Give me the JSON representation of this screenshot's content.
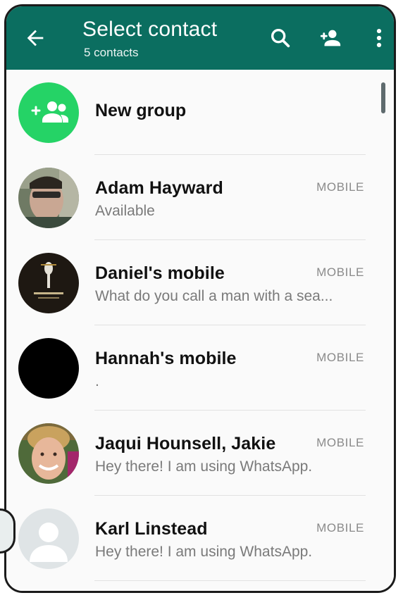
{
  "header": {
    "title": "Select contact",
    "subtitle": "5 contacts",
    "bg_color": "#0b6e60",
    "icons": [
      "back-arrow-icon",
      "search-icon",
      "add-contact-icon",
      "more-vert-icon"
    ]
  },
  "new_group": {
    "label": "New group",
    "icon": "group-add-icon",
    "accent": "#25d366"
  },
  "contacts": [
    {
      "name": "Adam Hayward",
      "status": "Available",
      "type": "MOBILE"
    },
    {
      "name": "Daniel's mobile",
      "status": "What do you call a man with a sea...",
      "type": "MOBILE"
    },
    {
      "name": "Hannah's mobile",
      "status": ".",
      "type": "MOBILE"
    },
    {
      "name": "Jaqui Hounsell, Jakie",
      "status": "Hey there! I am using WhatsApp.",
      "type": "MOBILE"
    },
    {
      "name": "Karl Linstead",
      "status": "Hey there! I am using WhatsApp.",
      "type": "MOBILE"
    }
  ]
}
